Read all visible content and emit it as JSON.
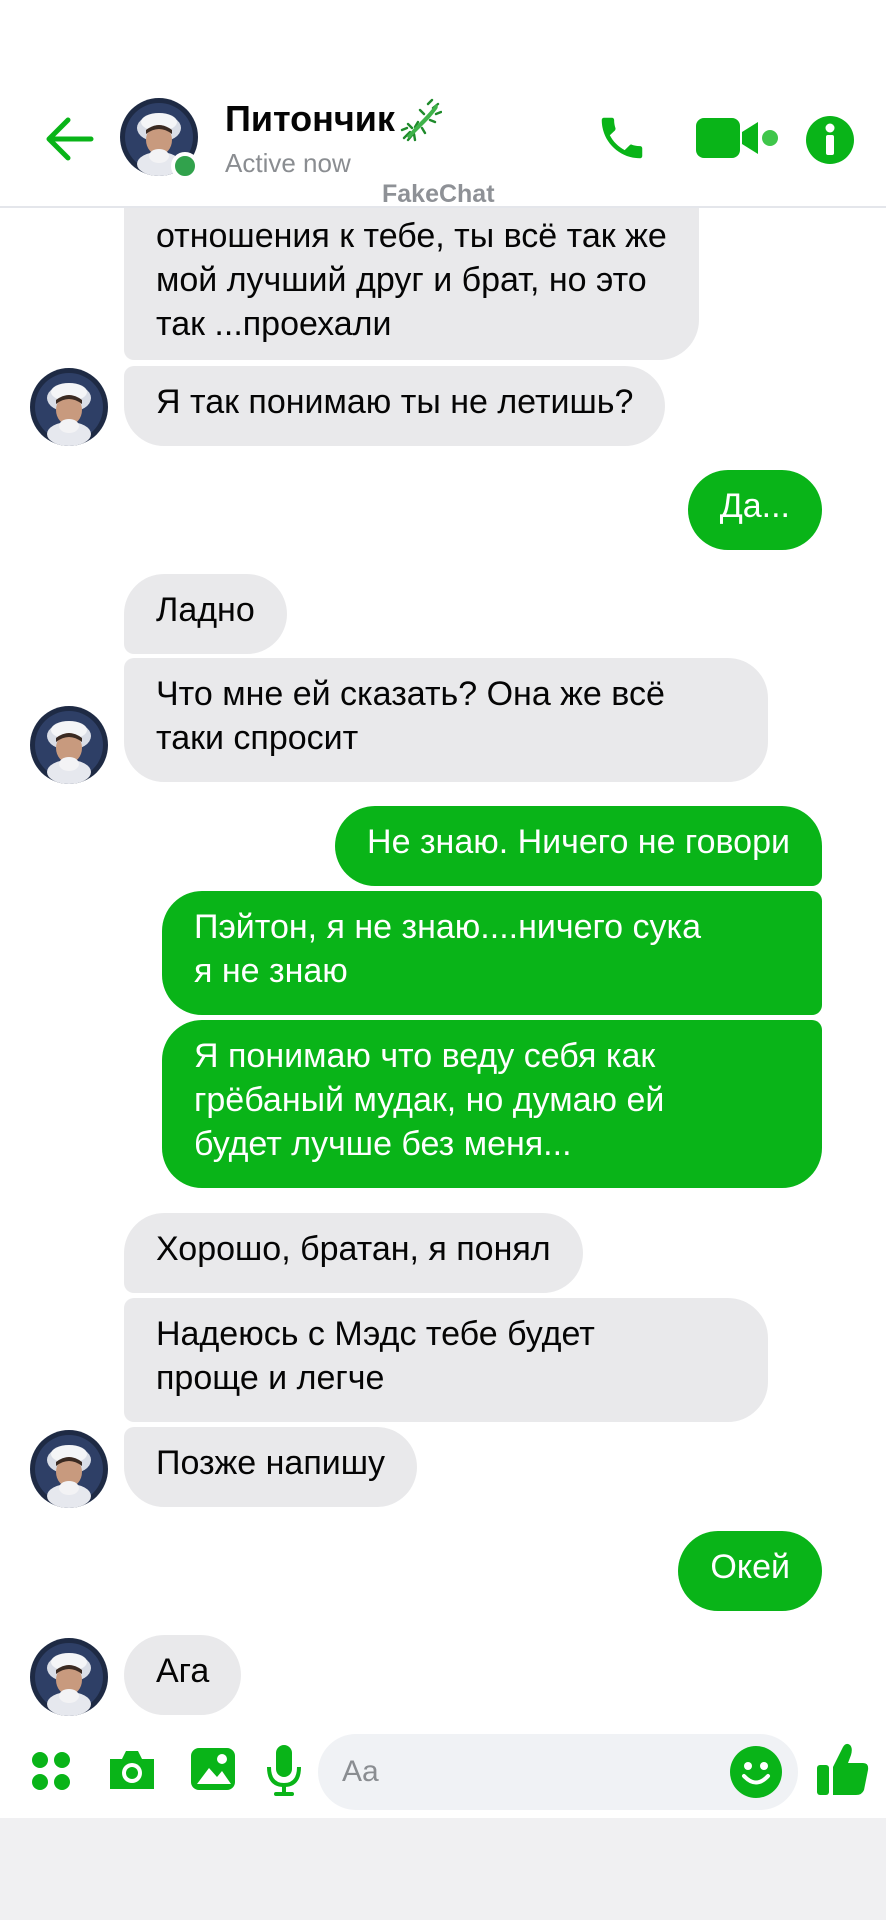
{
  "header": {
    "contact_name": "Питончик",
    "status": "Active now",
    "watermark": "FakeChat"
  },
  "theme": {
    "accent": "#09b418",
    "incoming_bubble": "#e9e9eb",
    "online": "#31a24c"
  },
  "messages": {
    "m0": {
      "direction": "in",
      "lines": [
        "отношения к тебе, ты всё так же",
        "мой лучший друг и брат, но это",
        "так ...проехали"
      ]
    },
    "m1": {
      "direction": "in",
      "lines": [
        "Я так понимаю ты не летишь?"
      ]
    },
    "m2": {
      "direction": "out",
      "lines": [
        "Да..."
      ]
    },
    "m3": {
      "direction": "in",
      "lines": [
        "Ладно"
      ]
    },
    "m4": {
      "direction": "in",
      "lines": [
        "Что мне ей сказать? Она же всё",
        "таки спросит"
      ]
    },
    "m5": {
      "direction": "out",
      "lines": [
        "Не знаю. Ничего не говори"
      ]
    },
    "m6": {
      "direction": "out",
      "lines": [
        "Пэйтон, я не знаю....ничего сука",
        "я не знаю"
      ]
    },
    "m7": {
      "direction": "out",
      "lines": [
        "Я понимаю что веду себя как",
        "грёбаный мудак, но думаю ей",
        "будет лучше без меня..."
      ]
    },
    "m8": {
      "direction": "in",
      "lines": [
        "Хорошо, братан, я понял"
      ]
    },
    "m9": {
      "direction": "in",
      "lines": [
        "Надеюсь с Мэдс тебе будет",
        "проще  и легче"
      ]
    },
    "m10": {
      "direction": "in",
      "lines": [
        "Позже напишу"
      ]
    },
    "m11": {
      "direction": "out",
      "lines": [
        "Окей"
      ]
    },
    "m12": {
      "direction": "in",
      "lines": [
        "Ага"
      ]
    }
  },
  "composer": {
    "placeholder": "Aa",
    "value": ""
  },
  "icons": {
    "back": "arrow-left-icon",
    "call": "phone-icon",
    "video": "video-camera-icon",
    "info": "info-icon",
    "apps": "four-dots-icon",
    "camera": "camera-icon",
    "gallery": "image-icon",
    "voice": "microphone-icon",
    "emoji": "smiley-icon",
    "like": "thumbs-up-icon"
  }
}
